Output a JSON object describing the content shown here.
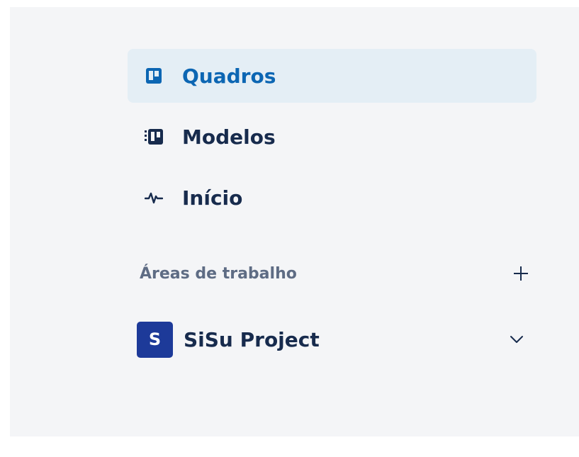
{
  "nav": {
    "items": [
      {
        "label": "Quadros",
        "icon": "board-icon",
        "active": true
      },
      {
        "label": "Modelos",
        "icon": "templates-icon",
        "active": false
      },
      {
        "label": "Início",
        "icon": "activity-icon",
        "active": false
      }
    ]
  },
  "workspaces": {
    "title": "Áreas de trabalho",
    "add_icon": "plus-icon",
    "items": [
      {
        "initial": "S",
        "name": "SiSu Project",
        "expand_icon": "chevron-down-icon"
      }
    ]
  },
  "colors": {
    "active_bg": "#e4eef5",
    "active_text": "#0c66b3",
    "text": "#172b4d",
    "muted": "#5e6c84",
    "workspace_avatar": "#1d3a99"
  }
}
